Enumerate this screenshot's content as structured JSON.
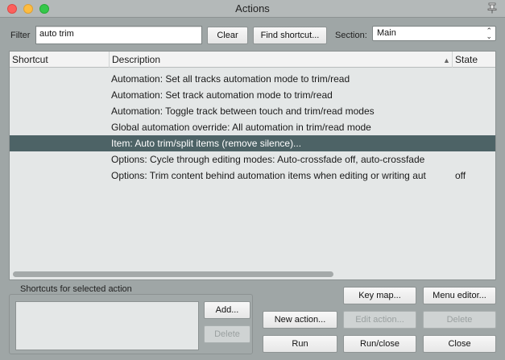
{
  "window": {
    "title": "Actions"
  },
  "filter": {
    "label": "Filter",
    "value": "auto trim"
  },
  "buttons": {
    "clear": "Clear",
    "find_shortcut": "Find shortcut...",
    "add": "Add...",
    "delete_shortcut": "Delete",
    "key_map": "Key map...",
    "menu_editor": "Menu editor...",
    "new_action": "New action...",
    "edit_action": "Edit action...",
    "delete_action": "Delete",
    "run": "Run",
    "run_close": "Run/close",
    "close": "Close"
  },
  "section": {
    "label": "Section:",
    "value": "Main"
  },
  "table": {
    "columns": [
      "Shortcut",
      "Description",
      "State"
    ],
    "rows": [
      {
        "shortcut": "",
        "description": "Automation: Set all tracks automation mode to trim/read",
        "state": "",
        "selected": false
      },
      {
        "shortcut": "",
        "description": "Automation: Set track automation mode to trim/read",
        "state": "",
        "selected": false
      },
      {
        "shortcut": "",
        "description": "Automation: Toggle track between touch and trim/read modes",
        "state": "",
        "selected": false
      },
      {
        "shortcut": "",
        "description": "Global automation override: All automation in trim/read mode",
        "state": "",
        "selected": false
      },
      {
        "shortcut": "",
        "description": "Item: Auto trim/split items (remove silence)...",
        "state": "",
        "selected": true
      },
      {
        "shortcut": "",
        "description": "Options: Cycle through editing modes: Auto-crossfade off, auto-crossfade",
        "state": "",
        "selected": false
      },
      {
        "shortcut": "",
        "description": "Options: Trim content behind automation items when editing or writing aut",
        "state": "off",
        "selected": false
      }
    ]
  },
  "shortcuts_group": {
    "label": "Shortcuts for selected action"
  },
  "icons": {
    "pin": "pin-icon",
    "sort": "sort-ascending-icon",
    "select": "chevron-updown-icon"
  },
  "colors": {
    "selection": "#4d6366",
    "window_bg": "#9fa6a6"
  }
}
